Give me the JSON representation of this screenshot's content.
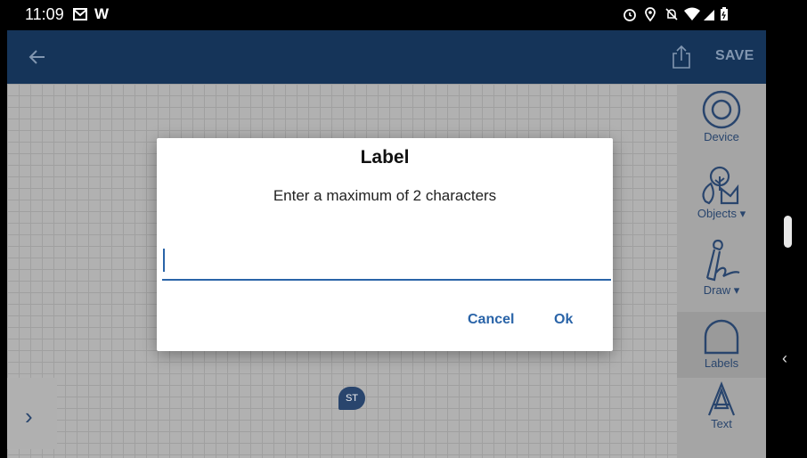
{
  "status_bar": {
    "time": "11:09",
    "app_glyph": "W",
    "icons": [
      "mail-icon",
      "alarm-icon",
      "location-icon",
      "notifications-off-icon",
      "wifi-icon",
      "signal-icon",
      "battery-icon"
    ]
  },
  "app_bar": {
    "back_icon": "arrow-left-icon",
    "share_icon": "share-icon",
    "save_label": "SAVE"
  },
  "sidebar": {
    "tools": [
      {
        "label": "Device",
        "icon": "device-target-icon"
      },
      {
        "label": "Objects ▾",
        "icon": "objects-tree-icon"
      },
      {
        "label": "Draw ▾",
        "icon": "draw-pen-icon"
      },
      {
        "label": "Labels",
        "icon": "label-bubble-icon",
        "selected": true
      },
      {
        "label": "Text",
        "icon": "text-a-icon"
      }
    ]
  },
  "canvas": {
    "marker_label": "ST",
    "expand_icon": "chevron-right-icon"
  },
  "dialog": {
    "title": "Label",
    "message": "Enter a maximum of 2 characters",
    "input_value": "",
    "cancel_label": "Cancel",
    "ok_label": "Ok"
  },
  "colors": {
    "app_bar": "#17385f",
    "accent": "#2a64a8",
    "tool_icon": "#2c4a74"
  }
}
